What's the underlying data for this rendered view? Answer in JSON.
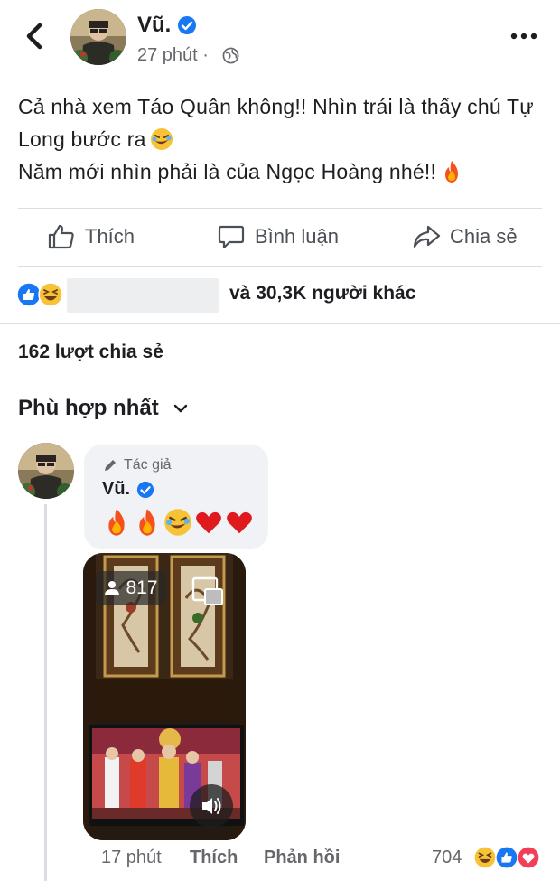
{
  "header": {
    "author": "Vũ.",
    "time": "27 phút",
    "separator": "·"
  },
  "post": {
    "line1": "Cả nhà xem Táo Quân không!! Nhìn trái là thấy chú Tự Long bước ra",
    "line2": "Năm mới nhìn phải là của Ngọc Hoàng nhé!!"
  },
  "actions": {
    "like": "Thích",
    "comment": "Bình luận",
    "share": "Chia sẻ"
  },
  "reactions": {
    "summary": "và 30,3K người khác"
  },
  "shares": "162 lượt chia sẻ",
  "sort": {
    "label": "Phù hợp nhất"
  },
  "comment": {
    "author_tag": "Tác giả",
    "author": "Vũ.",
    "video": {
      "viewers": "817"
    },
    "time": "17 phút",
    "like": "Thích",
    "reply": "Phản hồi",
    "reaction_count": "704"
  },
  "colors": {
    "accent": "#1877f2",
    "secondary_text": "#65676b",
    "divider": "#dadde1",
    "bubble": "#f0f2f5"
  },
  "icons": {
    "back": "chevron-left-icon",
    "globe": "globe-icon",
    "more": "more-dots-icon",
    "like": "thumbs-up-icon",
    "comment": "speech-bubble-icon",
    "share": "share-arrow-icon"
  }
}
